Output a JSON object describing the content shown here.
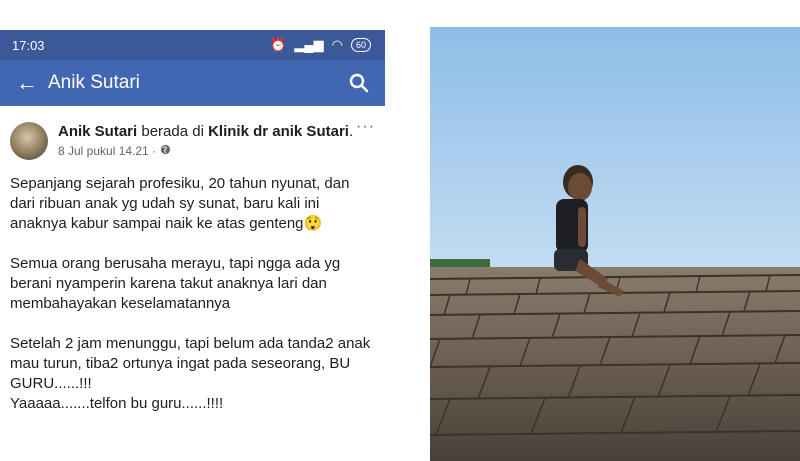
{
  "status": {
    "time": "17:03",
    "battery": "60"
  },
  "appbar": {
    "title": "Anik Sutari",
    "back_icon": "arrow-left-icon",
    "search_icon": "search-icon"
  },
  "post": {
    "author": "Anik Sutari",
    "at_text": " berada di ",
    "place": "Klinik dr anik Sutari",
    "place_suffix": ".",
    "date": "8 Jul pukul 14.21 · ",
    "more": "···",
    "paragraphs": [
      "Sepanjang sejarah profesiku, 20 tahun nyunat, dan dari ribuan anak yg udah sy sunat, baru kali ini anaknya kabur sampai naik ke atas genteng😲",
      "Semua orang berusaha merayu, tapi ngga ada yg berani nyamperin karena takut anaknya lari dan membahayakan keselamatannya",
      "Setelah 2 jam menunggu, tapi belum ada tanda2 anak mau turun, tiba2 ortunya ingat pada seseorang, BU GURU......!!!",
      "Yaaaaa.......telfon bu guru......!!!!"
    ]
  },
  "photo": {
    "subject": "child-sitting-on-roof",
    "sky_color": "#9ec6ec",
    "roof_color": "#6b5e52"
  }
}
